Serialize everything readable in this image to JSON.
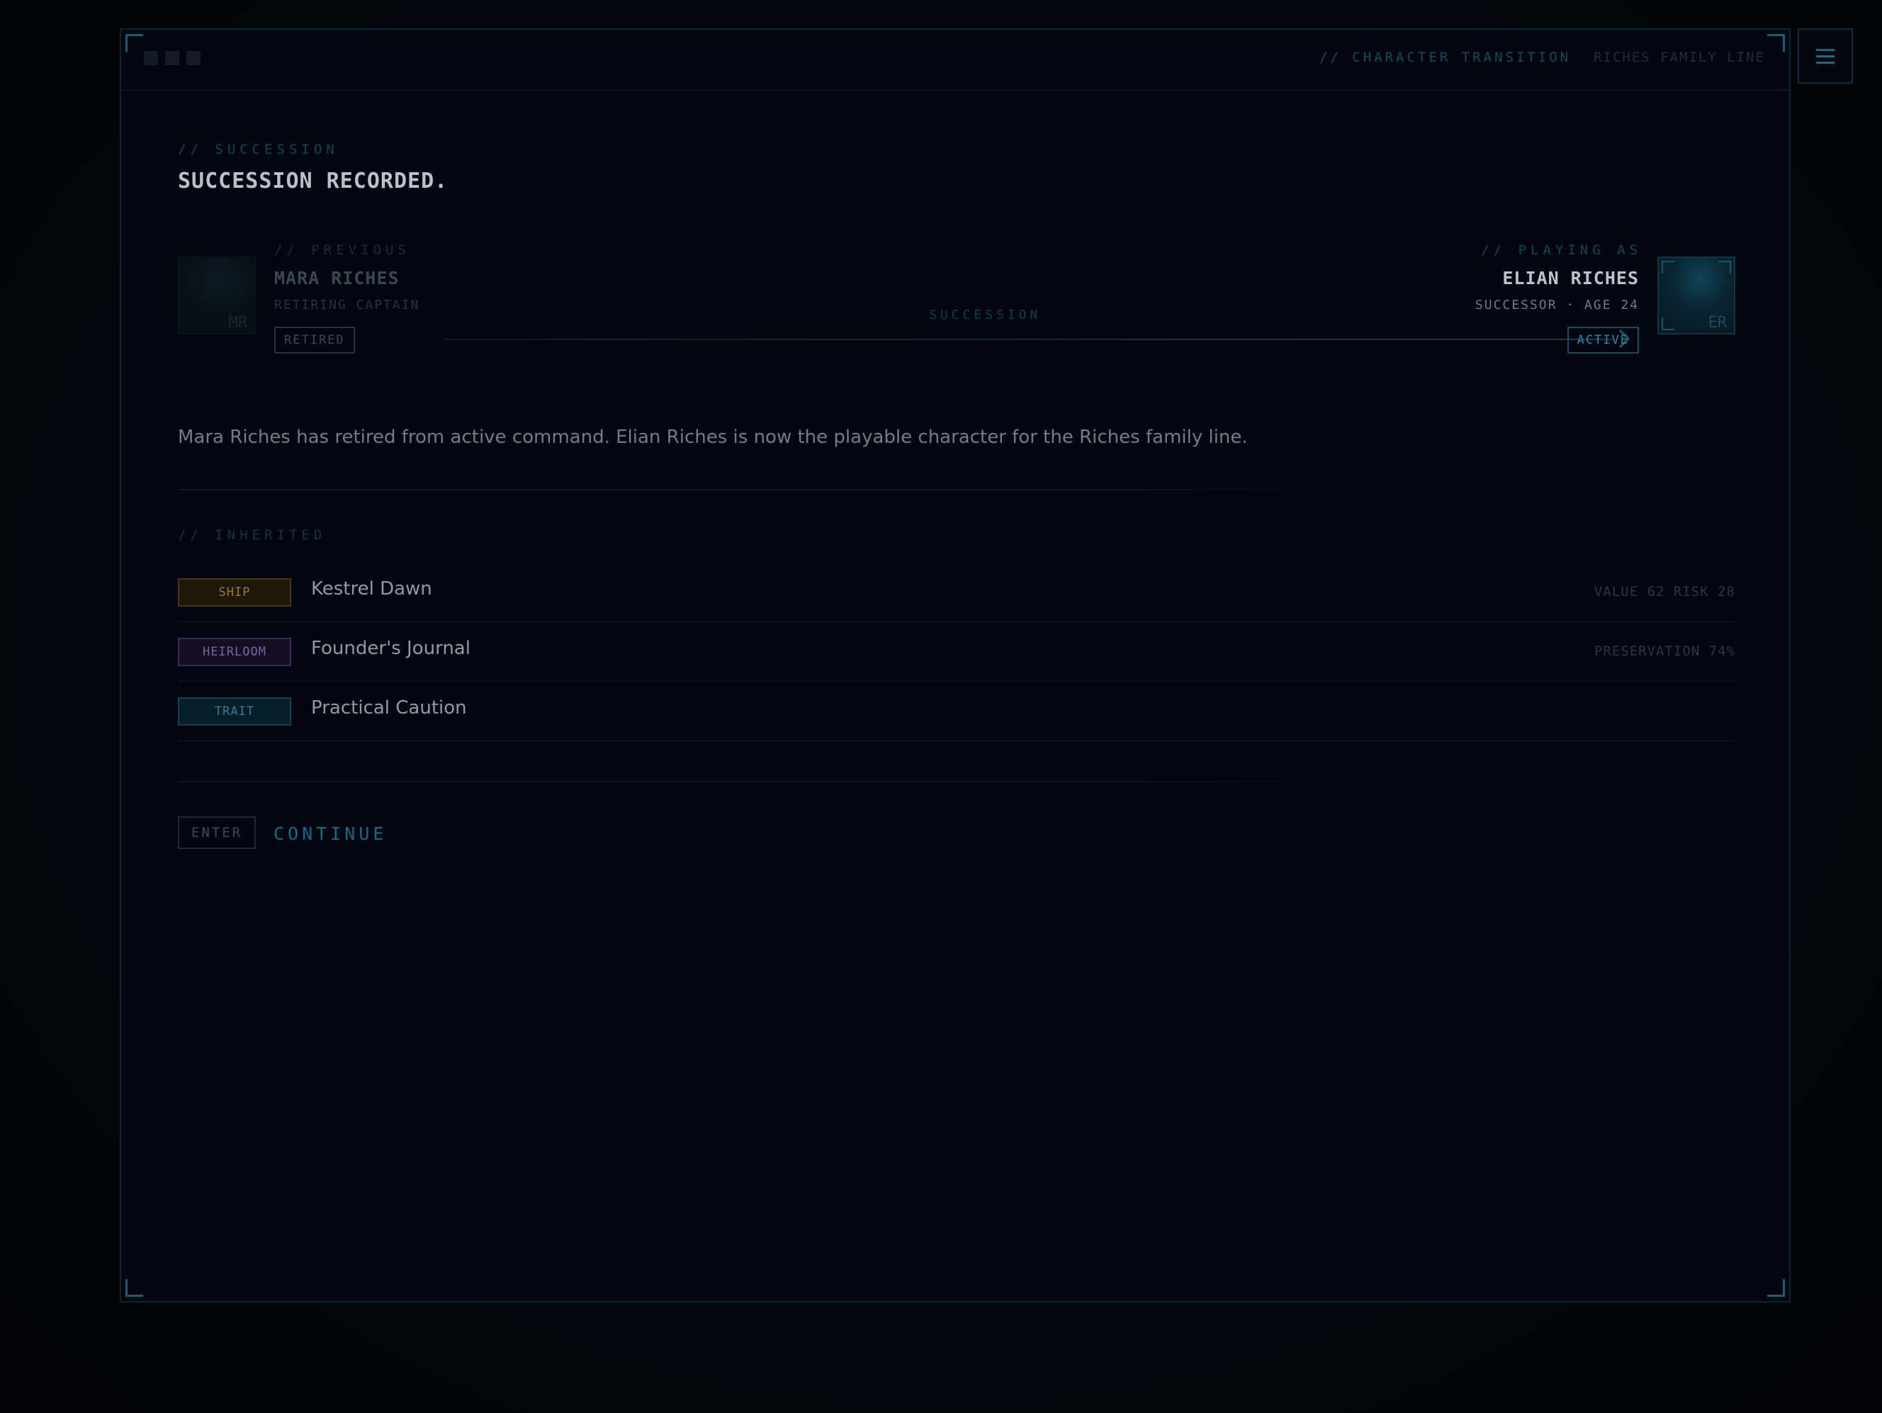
{
  "header": {
    "section_tag": "// CHARACTER TRANSITION",
    "family_line": "RICHES FAMILY LINE"
  },
  "succession": {
    "eyebrow": "// SUCCESSION",
    "title": "SUCCESSION RECORDED.",
    "flow_label": "SUCCESSION"
  },
  "previous": {
    "eyebrow": "// PREVIOUS",
    "name": "MARA RICHES",
    "role": "RETIRING CAPTAIN",
    "status": "RETIRED",
    "initials": "MR"
  },
  "current": {
    "eyebrow": "// PLAYING AS",
    "name": "ELIAN RICHES",
    "role": "SUCCESSOR · AGE 24",
    "status": "ACTIVE",
    "initials": "ER"
  },
  "description": "Mara Riches has retired from active command. Elian Riches is now the playable character for the Riches family line.",
  "inherited": {
    "eyebrow": "// INHERITED",
    "items": [
      {
        "tag": "SHIP",
        "name": "Kestrel Dawn",
        "stat": "VALUE 62 RISK 28",
        "tag_color": "#9a7a2c"
      },
      {
        "tag": "HEIRLOOM",
        "name": "Founder's Journal",
        "stat": "PRESERVATION 74%",
        "tag_color": "#7a64a0"
      },
      {
        "tag": "TRAIT",
        "name": "Practical Caution",
        "stat": "",
        "tag_color": "#2f7f94"
      }
    ]
  },
  "actions": {
    "key_hint": "ENTER",
    "continue_label": "CONTINUE"
  },
  "colors": {
    "accent": "#166a82",
    "background": "#03060b",
    "text_primary": "#b8c2cc"
  }
}
